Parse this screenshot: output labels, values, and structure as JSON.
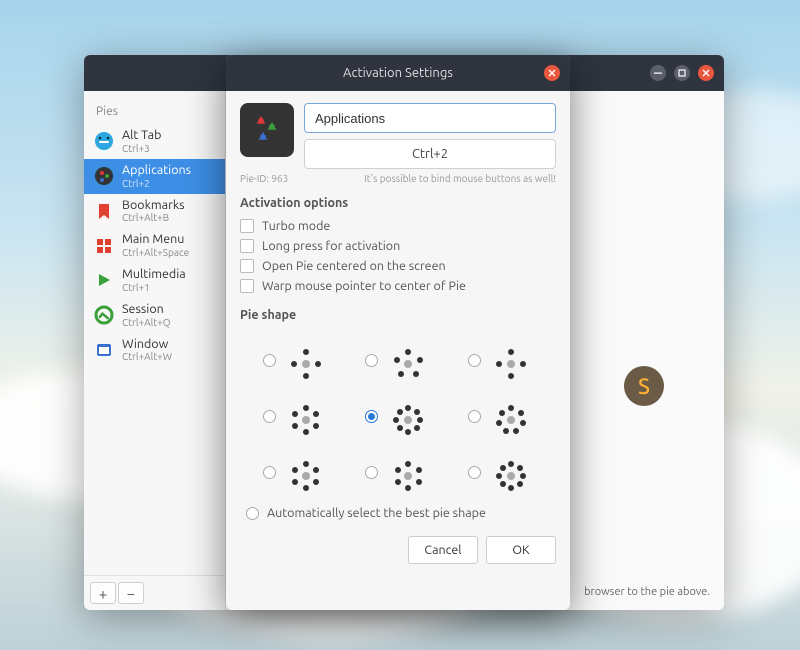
{
  "sidebar": {
    "heading": "Pies",
    "items": [
      {
        "label": "Alt Tab",
        "shortcut": "Ctrl+3",
        "selected": false
      },
      {
        "label": "Applications",
        "shortcut": "Ctrl+2",
        "selected": true
      },
      {
        "label": "Bookmarks",
        "shortcut": "Ctrl+Alt+B",
        "selected": false
      },
      {
        "label": "Main Menu",
        "shortcut": "Ctrl+Alt+Space",
        "selected": false
      },
      {
        "label": "Multimedia",
        "shortcut": "Ctrl+1",
        "selected": false
      },
      {
        "label": "Session",
        "shortcut": "Ctrl+Alt+Q",
        "selected": false
      },
      {
        "label": "Window",
        "shortcut": "Ctrl+Alt+W",
        "selected": false
      }
    ],
    "add_symbol": "+",
    "remove_symbol": "−"
  },
  "main_hint": "browser to the pie above.",
  "big_icon_letter": "S",
  "dialog": {
    "title": "Activation Settings",
    "name_value": "Applications",
    "binding_label": "Ctrl+2",
    "pie_id_label": "Pie-ID: 963",
    "mouse_hint": "It's possible to bind mouse buttons as well!",
    "activation_heading": "Activation options",
    "options": {
      "turbo": "Turbo mode",
      "longpress": "Long press for activation",
      "centered": "Open Pie centered on the screen",
      "warp": "Warp mouse pointer to center of Pie"
    },
    "shape_heading": "Pie shape",
    "shapes": {
      "selected_index": 4,
      "dot_counts": [
        4,
        5,
        4,
        6,
        8,
        7,
        6,
        6,
        8
      ]
    },
    "auto_shape_label": "Automatically select the best pie shape",
    "cancel_label": "Cancel",
    "ok_label": "OK"
  }
}
